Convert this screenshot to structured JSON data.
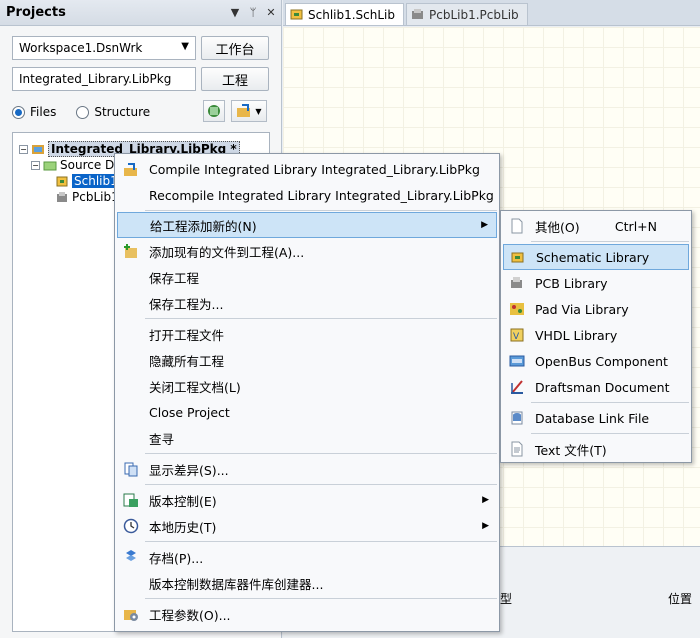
{
  "panel": {
    "title": "Projects",
    "header_buttons": [
      "▼",
      "ᛘ",
      "✕"
    ],
    "workspace": "Workspace1.DsnWrk",
    "workspace_button": "工作台",
    "project": "Integrated_Library.LibPkg",
    "project_button": "工程",
    "radio_files": "Files",
    "radio_structure": "Structure"
  },
  "tree": {
    "root": "Integrated_Library.LibPkg *",
    "source_docs": "Source Do",
    "schlib": "Schlib1",
    "pcblib": "PcbLib1"
  },
  "tabs": [
    {
      "label": "Schlib1.SchLib",
      "icon": "schlib-icon"
    },
    {
      "label": "PcbLib1.PcbLib",
      "icon": "pcblib-icon"
    }
  ],
  "doc": {
    "col_type": "型",
    "col_position": "位置"
  },
  "context_menu": {
    "items": [
      {
        "label": "Compile Integrated Library Integrated_Library.LibPkg",
        "icon": "compile-icon"
      },
      {
        "label": "Recompile Integrated Library Integrated_Library.LibPkg",
        "icon": ""
      },
      {
        "label": "给工程添加新的(N)",
        "icon": "",
        "submenu": true
      },
      {
        "label": "添加现有的文件到工程(A)...",
        "icon": "add-file-icon"
      },
      {
        "label": "保存工程",
        "icon": ""
      },
      {
        "label": "保存工程为...",
        "icon": ""
      },
      {
        "label": "打开工程文件",
        "icon": ""
      },
      {
        "label": "隐藏所有工程",
        "icon": ""
      },
      {
        "label": "关闭工程文档(L)",
        "icon": ""
      },
      {
        "label": "Close Project",
        "icon": ""
      },
      {
        "label": "查寻",
        "icon": ""
      },
      {
        "label": "显示差异(S)...",
        "icon": "diff-icon"
      },
      {
        "label": "版本控制(E)",
        "icon": "version-control-icon",
        "submenu": true
      },
      {
        "label": "本地历史(T)",
        "icon": "history-icon",
        "submenu": true
      },
      {
        "label": "存档(P)...",
        "icon": "archive-icon"
      },
      {
        "label": "版本控制数据库器件库创建器...",
        "icon": ""
      },
      {
        "label": "工程参数(O)...",
        "icon": "project-options-icon"
      }
    ]
  },
  "submenu": {
    "items": [
      {
        "label": "其他(O)",
        "shortcut": "Ctrl+N",
        "icon": "doc-icon"
      },
      {
        "label": "Schematic Library",
        "icon": "schematic-library-icon"
      },
      {
        "label": "PCB Library",
        "icon": "pcb-library-icon"
      },
      {
        "label": "Pad Via Library",
        "icon": "pad-via-library-icon"
      },
      {
        "label": "VHDL Library",
        "icon": "vhdl-library-icon"
      },
      {
        "label": "OpenBus Component",
        "icon": "openbus-icon"
      },
      {
        "label": "Draftsman Document",
        "icon": "draftsman-icon"
      },
      {
        "label": "Database Link File",
        "icon": "database-link-icon"
      },
      {
        "label": "Text  文件(T)",
        "icon": "text-file-icon"
      }
    ]
  },
  "colors": {
    "highlight": "#cde4f7",
    "selection": "#0a64c8",
    "accent": "#1769c4"
  }
}
